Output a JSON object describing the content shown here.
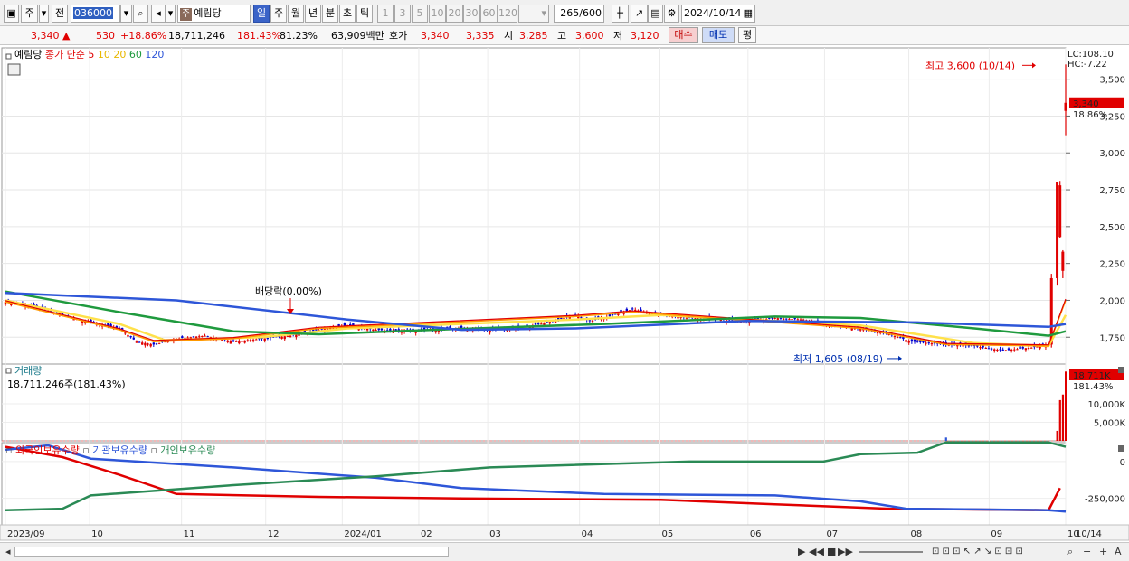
{
  "toolbar": {
    "period_label": "주",
    "prev_label": "전",
    "code": "036000",
    "stock_badge": "주",
    "stock_name": "예림당",
    "periods": [
      "일",
      "주",
      "월",
      "년",
      "분",
      "초",
      "틱"
    ],
    "minute_steps": [
      "1",
      "3",
      "5",
      "10",
      "20",
      "30",
      "60",
      "120"
    ],
    "count": "265",
    "count_total": "/600",
    "date": "2024/10/14"
  },
  "quote": {
    "price": "3,340",
    "change": "530",
    "change_pct": "+18.86%",
    "volume": "18,711,246",
    "volume_pct": "181.43%",
    "turnover_pct": "81.23%",
    "amount": "63,909백만",
    "hoga_label": "호가",
    "ask": "3,340",
    "bid": "3,335",
    "open_label": "시",
    "open": "3,285",
    "high_label": "고",
    "high": "3,600",
    "low_label": "저",
    "low": "3,120",
    "buy_label": "매수",
    "sell_label": "매도",
    "avg_label": "평"
  },
  "colors": {
    "up": "#e00000",
    "down": "#0000d0",
    "ma5": "#e00000",
    "ma10": "#ffd200",
    "ma20": "#ffd200",
    "ma60": "#1f9a3e",
    "ma120": "#2e56d8",
    "foreign": "#e00000",
    "institution": "#2e56d8",
    "individual": "#2a8a55"
  },
  "chart_data": [
    {
      "type": "candlestick",
      "panel": "price",
      "legend_name": "예림당",
      "legend_ma": [
        "종가 단순",
        "5",
        "10",
        "20",
        "60",
        "120"
      ],
      "ylim": [
        1580,
        3700
      ],
      "yticks": [
        1750,
        2000,
        2250,
        2500,
        2750,
        3000,
        3250,
        3500
      ],
      "ytick_labels": [
        "1,750",
        "2,000",
        "2,250",
        "2,500",
        "2,750",
        "3,000",
        "3,250",
        "3,500"
      ],
      "x_labels": [
        "2023/09",
        "10",
        "11",
        "12",
        "2024/01",
        "02",
        "03",
        "04",
        "05",
        "06",
        "07",
        "08",
        "09",
        "10",
        "10/14"
      ],
      "lc_label": "LC:108.10",
      "hc_label": "HC:-7.22",
      "last_price_label": "3,340",
      "last_change_label": "18.86%",
      "annotations": {
        "high": "최고 3,600 (10/14)",
        "low": "최저 1,605 (08/19)",
        "dividend": "배당락(0.00%)"
      },
      "close_series": [
        [
          0,
          1990
        ],
        [
          10,
          1960
        ],
        [
          20,
          1900
        ],
        [
          30,
          1850
        ],
        [
          40,
          1810
        ],
        [
          46,
          1720
        ],
        [
          52,
          1700
        ],
        [
          60,
          1740
        ],
        [
          70,
          1760
        ],
        [
          80,
          1720
        ],
        [
          90,
          1740
        ],
        [
          100,
          1760
        ],
        [
          110,
          1800
        ],
        [
          120,
          1830
        ],
        [
          130,
          1800
        ],
        [
          140,
          1790
        ],
        [
          150,
          1800
        ],
        [
          160,
          1810
        ],
        [
          170,
          1800
        ],
        [
          180,
          1810
        ],
        [
          190,
          1850
        ],
        [
          200,
          1900
        ],
        [
          205,
          1860
        ],
        [
          210,
          1880
        ],
        [
          220,
          1940
        ],
        [
          230,
          1900
        ],
        [
          240,
          1880
        ],
        [
          250,
          1870
        ],
        [
          260,
          1860
        ],
        [
          270,
          1880
        ],
        [
          280,
          1870
        ],
        [
          290,
          1830
        ],
        [
          300,
          1810
        ],
        [
          310,
          1770
        ],
        [
          318,
          1720
        ],
        [
          330,
          1700
        ],
        [
          340,
          1690
        ],
        [
          350,
          1660
        ],
        [
          360,
          1680
        ],
        [
          366,
          1700
        ],
        [
          368,
          2150
        ],
        [
          370,
          2500
        ],
        [
          371,
          2800
        ],
        [
          372,
          3340
        ]
      ],
      "ma60_series": [
        [
          0,
          2060
        ],
        [
          40,
          1920
        ],
        [
          80,
          1790
        ],
        [
          110,
          1770
        ],
        [
          150,
          1800
        ],
        [
          210,
          1840
        ],
        [
          270,
          1890
        ],
        [
          300,
          1880
        ],
        [
          340,
          1810
        ],
        [
          366,
          1760
        ],
        [
          372,
          1790
        ]
      ],
      "ma120_series": [
        [
          0,
          2050
        ],
        [
          60,
          2000
        ],
        [
          120,
          1870
        ],
        [
          160,
          1800
        ],
        [
          200,
          1810
        ],
        [
          260,
          1860
        ],
        [
          320,
          1850
        ],
        [
          366,
          1820
        ],
        [
          372,
          1840
        ]
      ],
      "ma5_series": [
        [
          0,
          1990
        ],
        [
          40,
          1800
        ],
        [
          52,
          1720
        ],
        [
          80,
          1740
        ],
        [
          110,
          1810
        ],
        [
          200,
          1890
        ],
        [
          220,
          1920
        ],
        [
          300,
          1810
        ],
        [
          330,
          1700
        ],
        [
          366,
          1690
        ],
        [
          372,
          2000
        ]
      ],
      "ma20_series": [
        [
          0,
          2000
        ],
        [
          40,
          1840
        ],
        [
          56,
          1730
        ],
        [
          90,
          1750
        ],
        [
          120,
          1810
        ],
        [
          200,
          1870
        ],
        [
          230,
          1900
        ],
        [
          300,
          1830
        ],
        [
          340,
          1710
        ],
        [
          366,
          1690
        ],
        [
          372,
          1900
        ]
      ]
    },
    {
      "type": "bar",
      "panel": "volume",
      "legend": "거래량",
      "info_label": "18,711,246주(181.43%)",
      "ylim": [
        0,
        20000000
      ],
      "yticks": [
        5000000,
        10000000
      ],
      "ytick_labels": [
        "5,000K",
        "10,000K"
      ],
      "last_label": "18,711K",
      "last_pct_label": "181.43%",
      "bars": [
        [
          330,
          900000
        ],
        [
          369,
          2700000
        ],
        [
          370,
          11000000
        ],
        [
          371,
          12500000
        ],
        [
          372,
          18711246
        ]
      ]
    },
    {
      "type": "line",
      "panel": "holdings",
      "series_names": [
        "외국인보유수량",
        "기관보유수량",
        "개인보유수량"
      ],
      "ylim": [
        -430000,
        110000
      ],
      "yticks": [
        0,
        -250000
      ],
      "ytick_labels": [
        "0",
        "-250,000"
      ],
      "series": [
        {
          "name": "외국인보유수량",
          "values": [
            [
              0,
              100000
            ],
            [
              20,
              30000
            ],
            [
              40,
              -90000
            ],
            [
              60,
              -220000
            ],
            [
              110,
              -240000
            ],
            [
              160,
              -250000
            ],
            [
              230,
              -260000
            ],
            [
              270,
              -290000
            ],
            [
              310,
              -320000
            ],
            [
              366,
              -330000
            ],
            [
              370,
              -180000
            ]
          ]
        },
        {
          "name": "기관보유수량",
          "values": [
            [
              0,
              80000
            ],
            [
              15,
              110000
            ],
            [
              30,
              20000
            ],
            [
              80,
              -40000
            ],
            [
              130,
              -110000
            ],
            [
              160,
              -180000
            ],
            [
              210,
              -220000
            ],
            [
              270,
              -230000
            ],
            [
              300,
              -270000
            ],
            [
              316,
              -320000
            ],
            [
              366,
              -330000
            ],
            [
              372,
              -340000
            ]
          ]
        },
        {
          "name": "개인보유수량",
          "values": [
            [
              0,
              -330000
            ],
            [
              20,
              -320000
            ],
            [
              30,
              -230000
            ],
            [
              80,
              -160000
            ],
            [
              130,
              -100000
            ],
            [
              170,
              -40000
            ],
            [
              240,
              0
            ],
            [
              287,
              0
            ],
            [
              300,
              50000
            ],
            [
              320,
              60000
            ],
            [
              330,
              130000
            ],
            [
              366,
              130000
            ],
            [
              372,
              100000
            ]
          ]
        }
      ]
    }
  ],
  "scroll": {
    "nav_buttons": [
      "▶",
      "◀◀",
      "■",
      "▶▶"
    ],
    "zoom_labels": [
      "−",
      "+",
      "A"
    ]
  }
}
